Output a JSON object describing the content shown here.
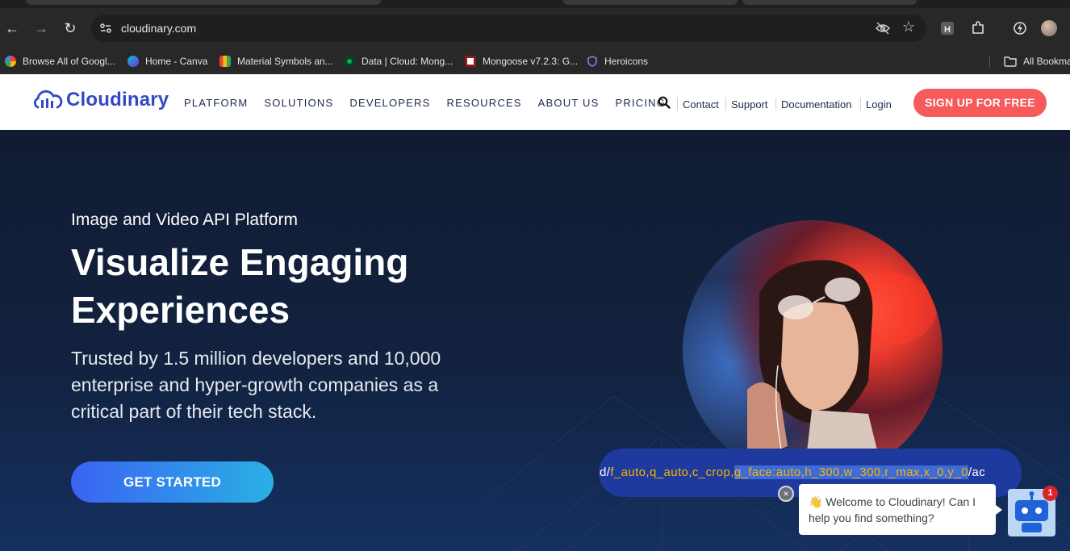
{
  "browser": {
    "url": "cloudinary.com",
    "bookmarks": [
      {
        "label": "Browse All of Googl...",
        "icon": "google-icon"
      },
      {
        "label": "Home - Canva",
        "icon": "canva-icon"
      },
      {
        "label": "Material Symbols an...",
        "icon": "material-symbols-icon"
      },
      {
        "label": "Data | Cloud: Mong...",
        "icon": "mongodb-leaf-icon"
      },
      {
        "label": "Mongoose v7.2.3: G...",
        "icon": "mongoose-icon"
      },
      {
        "label": "Heroicons",
        "icon": "heroicons-shield-icon"
      }
    ],
    "all_bookmarks": "All Bookma",
    "extension_h": "H"
  },
  "site": {
    "brand": "Cloudinary",
    "nav": [
      "PLATFORM",
      "SOLUTIONS",
      "DEVELOPERS",
      "RESOURCES",
      "ABOUT US",
      "PRICING"
    ],
    "util_links": [
      "Contact",
      "Support",
      "Documentation",
      "Login"
    ],
    "signup": "SIGN UP FOR FREE"
  },
  "hero": {
    "eyebrow": "Image and Video API Platform",
    "headline": "Visualize Engaging Experiences",
    "subtext": "Trusted by 1.5 million developers and 10,000 enterprise and hyper-growth companies as a critical part of their tech stack.",
    "cta": "GET STARTED",
    "url_demo": {
      "prefix": "d/",
      "params": "f_auto,q_auto,c_crop,",
      "highlighted": "g_face:auto,h_300,w_300,r_max,x_0,y_0",
      "suffix": "/ac"
    }
  },
  "chat": {
    "close": "×",
    "wave": "👋",
    "message": " Welcome to Cloudinary! Can I help you find something?",
    "badge": "1"
  },
  "colors": {
    "brand_blue": "#3448c5",
    "signup_red": "#f65a5a",
    "hero_bg": "#111c33",
    "code_yellow": "#f5b400"
  }
}
